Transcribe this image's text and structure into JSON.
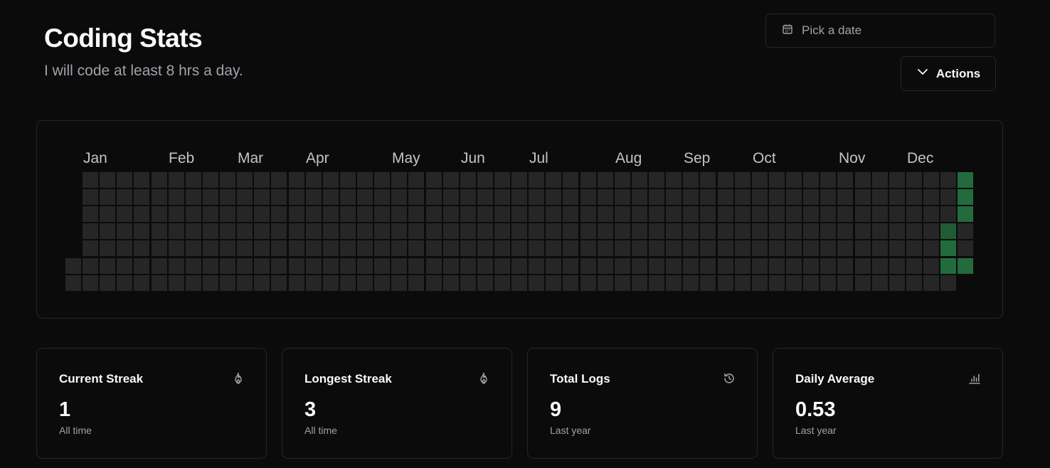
{
  "header": {
    "title": "Coding Stats",
    "subtitle": "I will code at least 8 hrs a day.",
    "date_picker_placeholder": "Pick a date",
    "actions_label": "Actions"
  },
  "heatmap": {
    "months": [
      "Jan",
      "Feb",
      "Mar",
      "Apr",
      "May",
      "Jun",
      "Jul",
      "Aug",
      "Sep",
      "Oct",
      "Nov",
      "Dec"
    ],
    "empty_color": "#262626",
    "active_colors": [
      "#1f5c34",
      "#236b3c"
    ],
    "active_cells": [
      {
        "week": 52,
        "day": 0,
        "level": 2
      },
      {
        "week": 52,
        "day": 1,
        "level": 2
      },
      {
        "week": 52,
        "day": 2,
        "level": 2
      },
      {
        "week": 51,
        "day": 3,
        "level": 1
      },
      {
        "week": 51,
        "day": 4,
        "level": 2
      },
      {
        "week": 51,
        "day": 5,
        "level": 2
      },
      {
        "week": 52,
        "day": 5,
        "level": 2
      }
    ]
  },
  "stats": [
    {
      "title": "Current Streak",
      "value": "1",
      "caption": "All time",
      "icon": "flame-icon"
    },
    {
      "title": "Longest Streak",
      "value": "3",
      "caption": "All time",
      "icon": "flame-icon"
    },
    {
      "title": "Total Logs",
      "value": "9",
      "caption": "Last year",
      "icon": "history-icon"
    },
    {
      "title": "Daily Average",
      "value": "0.53",
      "caption": "Last year",
      "icon": "bar-chart-icon"
    }
  ],
  "colors": {
    "background": "#0b0b0b",
    "border": "#262626",
    "muted_text": "#a1a1aa"
  }
}
